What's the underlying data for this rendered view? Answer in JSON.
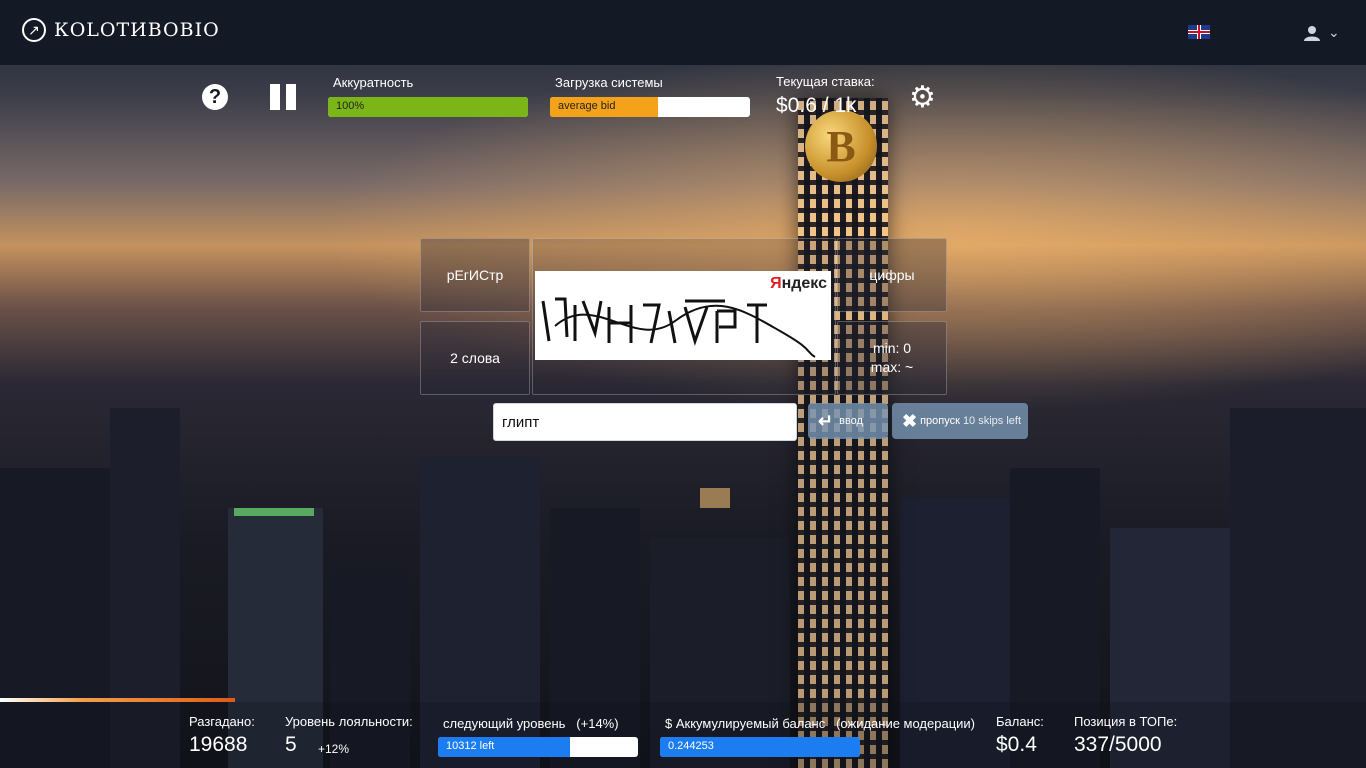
{
  "navbar": {
    "logo_text": "КOLОТИBOBIO",
    "language_flag": "uk-flag",
    "user_icon": "user-icon",
    "caret": "chevron-down-icon"
  },
  "controls": {
    "help_symbol": "?",
    "accuracy": {
      "label": "Аккуратность",
      "value_text": "100%",
      "fill_fraction": 1.0,
      "color": "#7cb518"
    },
    "system_load": {
      "label": "Загрузка системы",
      "value_text": "average bid",
      "fill_fraction": 0.54,
      "color": "#f5a21b"
    },
    "rate": {
      "label": "Текущая ставка:",
      "value": "$0.6 / 1k"
    }
  },
  "captcha": {
    "case_hint": "рЕгИСтр",
    "words_hint": "2 слова",
    "digits_hint": "цифры",
    "min_text": "min: 0",
    "max_text": "max: ~",
    "provider_first": "Я",
    "provider_rest": "ндекс",
    "answer_value": "глипт",
    "submit_label": "ввод",
    "skip_label": "пропуск",
    "skips_left": "10 skips left"
  },
  "stats": {
    "solved": {
      "label": "Разгадано:",
      "value": "19688"
    },
    "loyalty": {
      "label": "Уровень лояльности:",
      "value": "5",
      "bonus": "+12%"
    },
    "next_level": {
      "label": "следующий уровень",
      "bonus": "(+14%)",
      "bar_text": "10312 left",
      "fill_fraction": 0.66,
      "color": "#1b7df0"
    },
    "accumulated": {
      "label": "$ Аккумулируемый баланс",
      "note": "(ожидание модерации)",
      "bar_text": "0.244253",
      "fill_fraction": 1.0,
      "color": "#1b7df0"
    },
    "balance": {
      "label": "Баланс:",
      "value": "$0.4"
    },
    "top_position": {
      "label": "Позиция в ТОПе:",
      "value": "337/5000"
    }
  }
}
